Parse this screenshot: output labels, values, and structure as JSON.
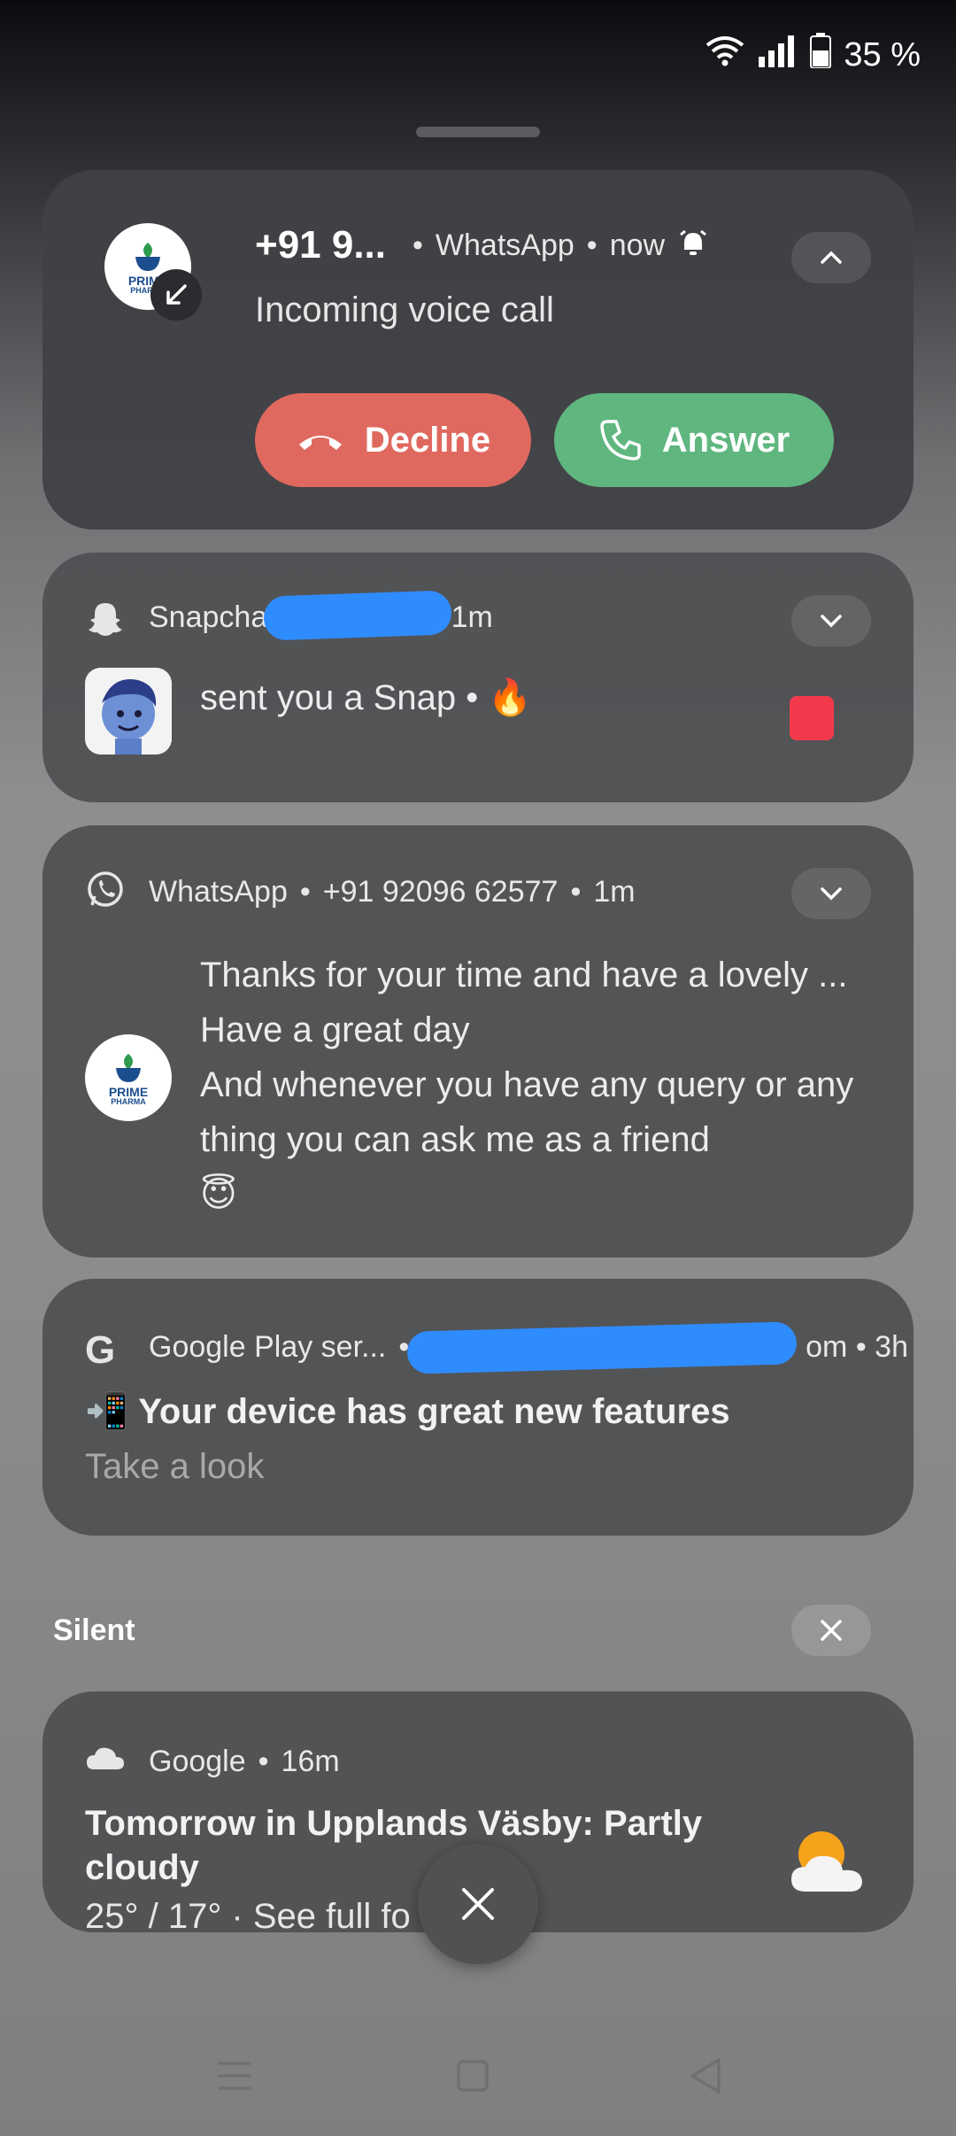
{
  "status_bar": {
    "battery": "35 %"
  },
  "call_notification": {
    "avatar_text": "PRIME",
    "avatar_sub": "PHARMA",
    "caller": "+91 9...",
    "app": "WhatsApp",
    "time": "now",
    "subtitle": "Incoming voice call",
    "decline_label": "Decline",
    "answer_label": "Answer"
  },
  "snapchat_notification": {
    "app": "Snapchat",
    "time": "1m",
    "message": "sent you a Snap • 🔥",
    "indicator_color": "#f23a4c"
  },
  "whatsapp_notification": {
    "app": "WhatsApp",
    "sender": "+91 92096 62577",
    "time": "1m",
    "avatar_text": "PRIME",
    "avatar_sub": "PHARMA",
    "lines": [
      "Thanks for your time and have a lovely ...",
      "Have a great day",
      "And whenever you have any query or any",
      "thing you can ask me as a friend",
      "😇"
    ]
  },
  "google_play_notification": {
    "app": "Google Play ser...",
    "trailing": "om • 3h",
    "title": "📲 Your device has great new features",
    "body": "Take a look"
  },
  "silent_section": {
    "label": "Silent"
  },
  "weather_notification": {
    "app": "Google",
    "time": "16m",
    "title": "Tomorrow in Upplands Väsby: Partly cloudy",
    "body": "25° / 17° · See full fo"
  },
  "icons": [
    "wifi-icon",
    "signal-icon",
    "battery-icon",
    "call-incoming-icon",
    "alarm-icon",
    "chevron-up-icon",
    "chevron-down-icon",
    "phone-decline-icon",
    "phone-answer-icon",
    "snapchat-ghost-icon",
    "whatsapp-icon",
    "google-g-icon",
    "cloud-icon",
    "close-icon",
    "weather-partly-cloudy-icon"
  ]
}
